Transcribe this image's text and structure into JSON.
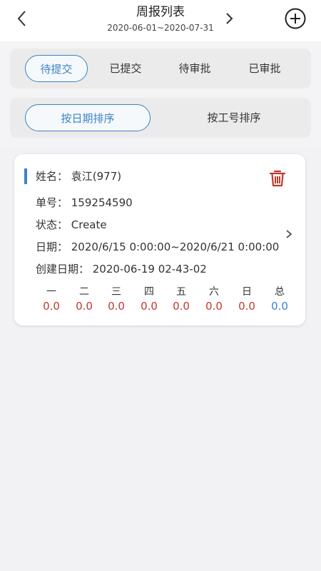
{
  "header": {
    "title": "周报列表",
    "date_range": "2020-06-01~2020-07-31"
  },
  "status_tabs": [
    {
      "label": "待提交",
      "active": true
    },
    {
      "label": "已提交",
      "active": false
    },
    {
      "label": "待审批",
      "active": false
    },
    {
      "label": "已审批",
      "active": false
    }
  ],
  "sort_tabs": [
    {
      "label": "按日期排序",
      "active": true
    },
    {
      "label": "按工号排序",
      "active": false
    }
  ],
  "report": {
    "name_line": "姓名：  袁江(977)",
    "number_line": "单号：  159254590",
    "status_line": "状态：  Create",
    "date_line": "日期：  2020/6/15 0:00:00~2020/6/21 0:00:00",
    "created_line": "创建日期：  2020-06-19 02-43-02",
    "week_headers": [
      "一",
      "二",
      "三",
      "四",
      "五",
      "六",
      "日",
      "总"
    ],
    "week_values": [
      "0.0",
      "0.0",
      "0.0",
      "0.0",
      "0.0",
      "0.0",
      "0.0",
      "0.0"
    ]
  },
  "colors": {
    "accent": "#3b84c4",
    "delete": "#c0392b",
    "value": "#c0392b"
  },
  "icons": {
    "back": "chevron-left-icon",
    "next": "chevron-right-icon",
    "add": "plus-circle-icon",
    "delete": "trash-icon"
  }
}
